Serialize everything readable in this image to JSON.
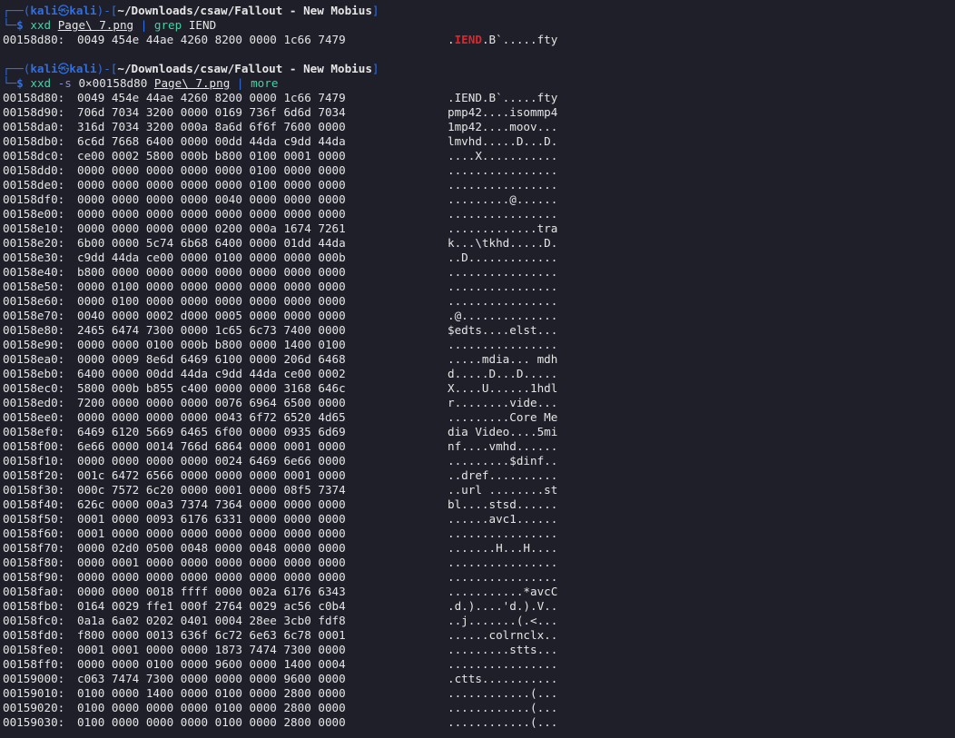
{
  "theme": {
    "background": "#1e1f29",
    "text": "#e6e6e6",
    "prompt_blue": "#2f6fe4",
    "command_green": "#38d8a6",
    "grep_match_red": "#e0262b"
  },
  "commands": [
    {
      "prompt": {
        "box_open": "┌──(",
        "user": "kali",
        "at_icon": "㉿",
        "host": "kali",
        "box_mid": ")-[",
        "path": "~/Downloads/csaw/Fallout - New Mobius",
        "box_close": "]",
        "dollar_prefix": "└─",
        "dollar": "$"
      },
      "tokens": [
        "xxd",
        "Page\\ 7.png",
        "|",
        "grep",
        "IEND"
      ],
      "output": [
        {
          "offset": "00158d80:",
          "hex": "0049 454e 44ae 4260 8200 0000 1c66 7479",
          "ascii_pre": ".",
          "ascii_match": "IEND",
          "ascii_post": ".B`.....fty"
        }
      ]
    },
    {
      "prompt": {
        "box_open": "┌──(",
        "user": "kali",
        "at_icon": "㉿",
        "host": "kali",
        "box_mid": ")-[",
        "path": "~/Downloads/csaw/Fallout - New Mobius",
        "box_close": "]",
        "dollar_prefix": "└─",
        "dollar": "$"
      },
      "tokens": [
        "xxd",
        "-s",
        "0×00158d80",
        "Page\\ 7.png",
        "|",
        "more"
      ],
      "output": [
        {
          "offset": "00158d80:",
          "hex": "0049 454e 44ae 4260 8200 0000 1c66 7479",
          "ascii": ".IEND.B`.....fty"
        },
        {
          "offset": "00158d90:",
          "hex": "706d 7034 3200 0000 0169 736f 6d6d 7034",
          "ascii": "pmp42....isommp4"
        },
        {
          "offset": "00158da0:",
          "hex": "316d 7034 3200 000a 8a6d 6f6f 7600 0000",
          "ascii": "1mp42....moov..."
        },
        {
          "offset": "00158db0:",
          "hex": "6c6d 7668 6400 0000 00dd 44da c9dd 44da",
          "ascii": "lmvhd.....D...D."
        },
        {
          "offset": "00158dc0:",
          "hex": "ce00 0002 5800 000b b800 0100 0001 0000",
          "ascii": "....X..........."
        },
        {
          "offset": "00158dd0:",
          "hex": "0000 0000 0000 0000 0000 0100 0000 0000",
          "ascii": "................"
        },
        {
          "offset": "00158de0:",
          "hex": "0000 0000 0000 0000 0000 0100 0000 0000",
          "ascii": "................"
        },
        {
          "offset": "00158df0:",
          "hex": "0000 0000 0000 0000 0040 0000 0000 0000",
          "ascii": ".........@......"
        },
        {
          "offset": "00158e00:",
          "hex": "0000 0000 0000 0000 0000 0000 0000 0000",
          "ascii": "................"
        },
        {
          "offset": "00158e10:",
          "hex": "0000 0000 0000 0000 0200 000a 1674 7261",
          "ascii": ".............tra"
        },
        {
          "offset": "00158e20:",
          "hex": "6b00 0000 5c74 6b68 6400 0000 01dd 44da",
          "ascii": "k...\\tkhd.....D."
        },
        {
          "offset": "00158e30:",
          "hex": "c9dd 44da ce00 0000 0100 0000 0000 000b",
          "ascii": "..D............."
        },
        {
          "offset": "00158e40:",
          "hex": "b800 0000 0000 0000 0000 0000 0000 0000",
          "ascii": "................"
        },
        {
          "offset": "00158e50:",
          "hex": "0000 0100 0000 0000 0000 0000 0000 0000",
          "ascii": "................"
        },
        {
          "offset": "00158e60:",
          "hex": "0000 0100 0000 0000 0000 0000 0000 0000",
          "ascii": "................"
        },
        {
          "offset": "00158e70:",
          "hex": "0040 0000 0002 d000 0005 0000 0000 0000",
          "ascii": ".@.............."
        },
        {
          "offset": "00158e80:",
          "hex": "2465 6474 7300 0000 1c65 6c73 7400 0000",
          "ascii": "$edts....elst..."
        },
        {
          "offset": "00158e90:",
          "hex": "0000 0000 0100 000b b800 0000 1400 0100",
          "ascii": "................"
        },
        {
          "offset": "00158ea0:",
          "hex": "0000 0009 8e6d 6469 6100 0000 206d 6468",
          "ascii": ".....mdia... mdh"
        },
        {
          "offset": "00158eb0:",
          "hex": "6400 0000 00dd 44da c9dd 44da ce00 0002",
          "ascii": "d.....D...D....."
        },
        {
          "offset": "00158ec0:",
          "hex": "5800 000b b855 c400 0000 0000 3168 646c",
          "ascii": "X....U......1hdl"
        },
        {
          "offset": "00158ed0:",
          "hex": "7200 0000 0000 0000 0076 6964 6500 0000",
          "ascii": "r........vide..."
        },
        {
          "offset": "00158ee0:",
          "hex": "0000 0000 0000 0000 0043 6f72 6520 4d65",
          "ascii": ".........Core Me"
        },
        {
          "offset": "00158ef0:",
          "hex": "6469 6120 5669 6465 6f00 0000 0935 6d69",
          "ascii": "dia Video....5mi"
        },
        {
          "offset": "00158f00:",
          "hex": "6e66 0000 0014 766d 6864 0000 0001 0000",
          "ascii": "nf....vmhd......"
        },
        {
          "offset": "00158f10:",
          "hex": "0000 0000 0000 0000 0024 6469 6e66 0000",
          "ascii": ".........$dinf.."
        },
        {
          "offset": "00158f20:",
          "hex": "001c 6472 6566 0000 0000 0000 0001 0000",
          "ascii": "..dref.........."
        },
        {
          "offset": "00158f30:",
          "hex": "000c 7572 6c20 0000 0001 0000 08f5 7374",
          "ascii": "..url ........st"
        },
        {
          "offset": "00158f40:",
          "hex": "626c 0000 00a3 7374 7364 0000 0000 0000",
          "ascii": "bl....stsd......"
        },
        {
          "offset": "00158f50:",
          "hex": "0001 0000 0093 6176 6331 0000 0000 0000",
          "ascii": "......avc1......"
        },
        {
          "offset": "00158f60:",
          "hex": "0001 0000 0000 0000 0000 0000 0000 0000",
          "ascii": "................"
        },
        {
          "offset": "00158f70:",
          "hex": "0000 02d0 0500 0048 0000 0048 0000 0000",
          "ascii": ".......H...H...."
        },
        {
          "offset": "00158f80:",
          "hex": "0000 0001 0000 0000 0000 0000 0000 0000",
          "ascii": "................"
        },
        {
          "offset": "00158f90:",
          "hex": "0000 0000 0000 0000 0000 0000 0000 0000",
          "ascii": "................"
        },
        {
          "offset": "00158fa0:",
          "hex": "0000 0000 0018 ffff 0000 002a 6176 6343",
          "ascii": "...........*avcC"
        },
        {
          "offset": "00158fb0:",
          "hex": "0164 0029 ffe1 000f 2764 0029 ac56 c0b4",
          "ascii": ".d.)....'d.).V.."
        },
        {
          "offset": "00158fc0:",
          "hex": "0a1a 6a02 0202 0401 0004 28ee 3cb0 fdf8",
          "ascii": "..j.......(.<..."
        },
        {
          "offset": "00158fd0:",
          "hex": "f800 0000 0013 636f 6c72 6e63 6c78 0001",
          "ascii": "......colrnclx.."
        },
        {
          "offset": "00158fe0:",
          "hex": "0001 0001 0000 0000 1873 7474 7300 0000",
          "ascii": ".........stts..."
        },
        {
          "offset": "00158ff0:",
          "hex": "0000 0000 0100 0000 9600 0000 1400 0004",
          "ascii": "................"
        },
        {
          "offset": "00159000:",
          "hex": "c063 7474 7300 0000 0000 0000 9600 0000",
          "ascii": ".ctts..........."
        },
        {
          "offset": "00159010:",
          "hex": "0100 0000 1400 0000 0100 0000 2800 0000",
          "ascii": "............(..."
        },
        {
          "offset": "00159020:",
          "hex": "0100 0000 0000 0000 0100 0000 2800 0000",
          "ascii": "............(..."
        },
        {
          "offset": "00159030:",
          "hex": "0100 0000 0000 0000 0100 0000 2800 0000",
          "ascii": "............(..."
        }
      ]
    }
  ]
}
